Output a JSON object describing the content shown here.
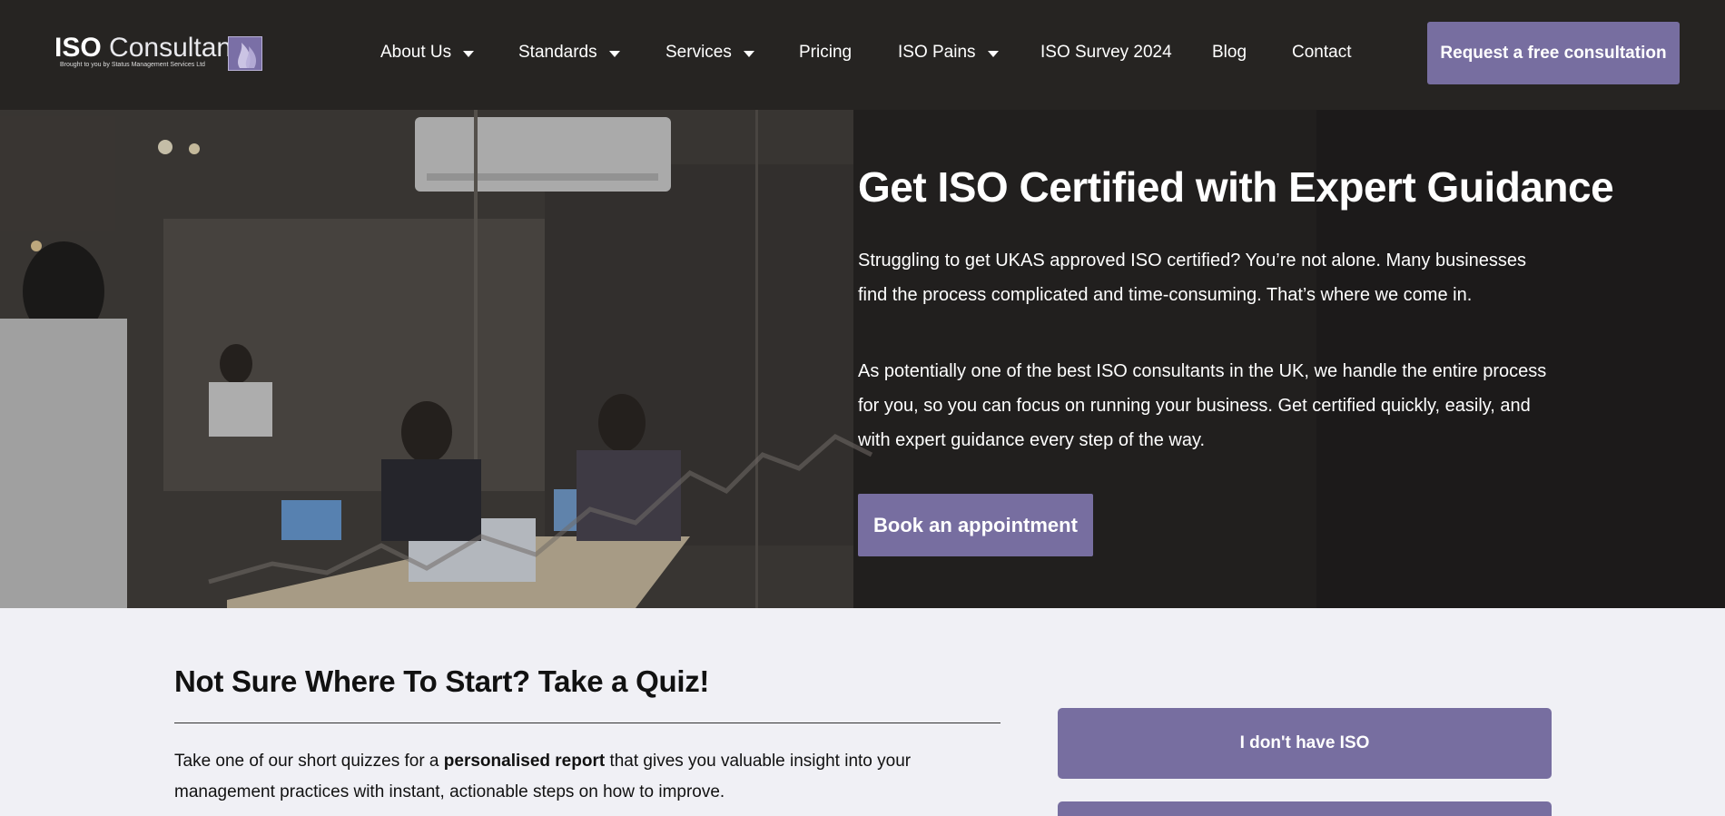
{
  "header": {
    "logo": {
      "main_bold": "ISO",
      "main_light": "Consultants",
      "tagline": "Brought to you by Status Management Services Ltd"
    },
    "nav": [
      {
        "label": "About Us",
        "dropdown": true
      },
      {
        "label": "Standards",
        "dropdown": true
      },
      {
        "label": "Services",
        "dropdown": true
      },
      {
        "label": "Pricing",
        "dropdown": false
      },
      {
        "label": "ISO Pains",
        "dropdown": true
      },
      {
        "label": "ISO Survey 2024",
        "dropdown": false
      },
      {
        "label": "Blog",
        "dropdown": false
      },
      {
        "label": "Contact",
        "dropdown": false
      }
    ],
    "cta_label": "Request a free consultation"
  },
  "hero": {
    "title": "Get ISO Certified with Expert Guidance",
    "paragraph_1": "Struggling to get UKAS approved ISO certified? You’re not alone. Many businesses find the process complicated and time-consuming. That’s where we come in.",
    "paragraph_2": "As potentially one of the best ISO consultants in the UK, we handle the entire process for you, so you can focus on running your business. Get certified quickly, easily, and with expert guidance every step of the way.",
    "button_label": "Book an appointment"
  },
  "quiz": {
    "title": "Not Sure Where To Start? Take a Quiz!",
    "text_before": "Take one of our short quizzes for a ",
    "text_bold": "personalised report",
    "text_after": " that gives you valuable insight into your management practices with instant, actionable steps on how to improve.",
    "buttons": [
      "I don't have ISO"
    ]
  },
  "colors": {
    "header_bg": "#262422",
    "accent": "#776ea0",
    "page_bg": "#f0f0f5"
  }
}
